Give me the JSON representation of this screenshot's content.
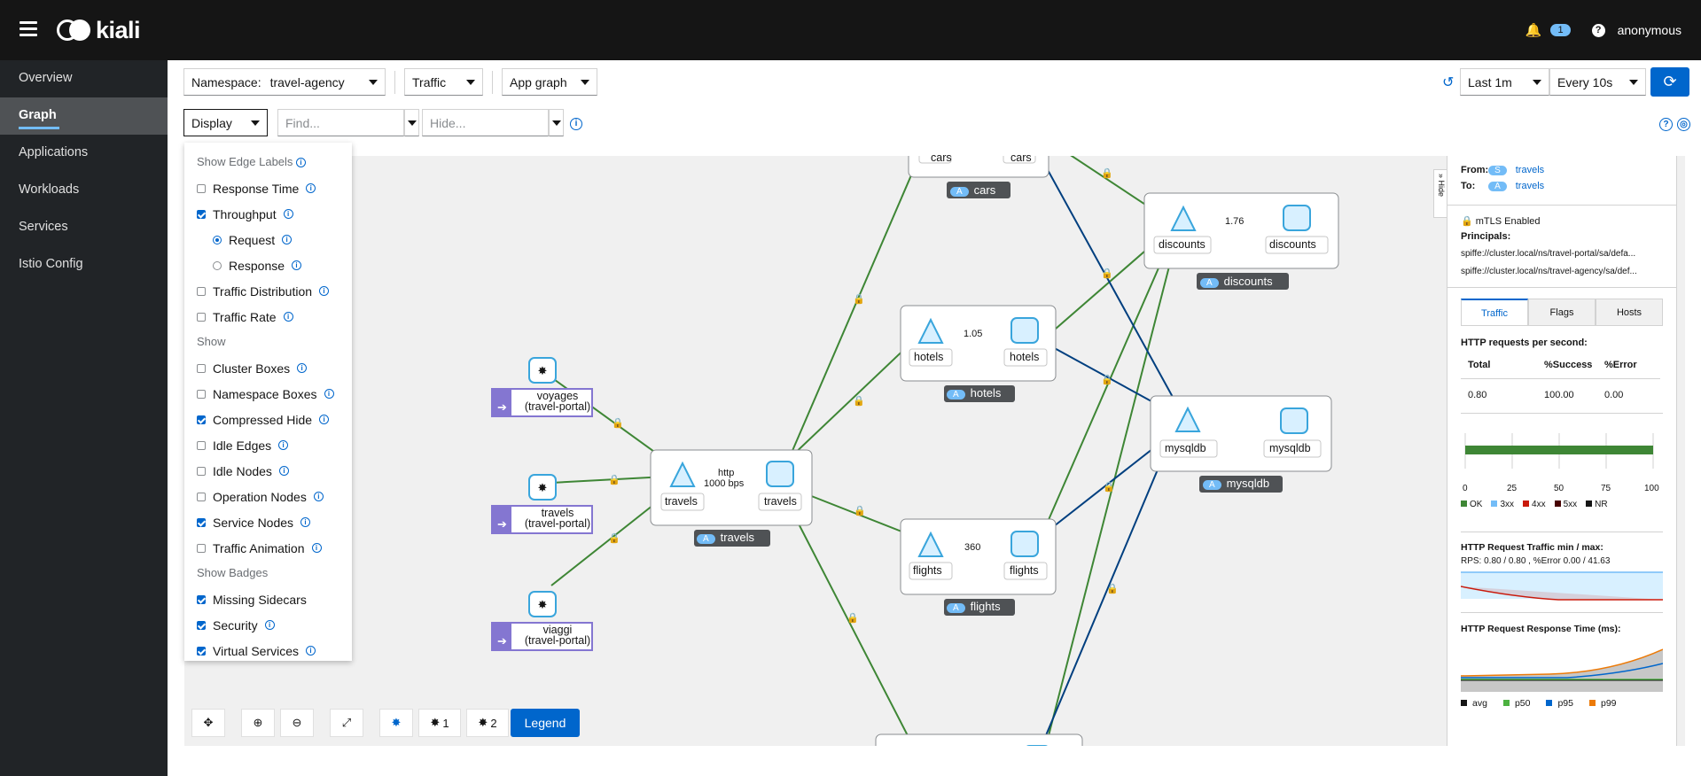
{
  "masthead": {
    "brand": "kiali",
    "notifications_count": "1",
    "user": "anonymous"
  },
  "sidebar": {
    "items": [
      {
        "label": "Overview"
      },
      {
        "label": "Graph"
      },
      {
        "label": "Applications"
      },
      {
        "label": "Workloads"
      },
      {
        "label": "Services"
      },
      {
        "label": "Istio Config"
      }
    ]
  },
  "toolbar": {
    "namespace_label": "Namespace:",
    "namespace_value": "travel-agency",
    "edge_label_select": "Traffic",
    "graph_type_select": "App graph",
    "duration": "Last 1m",
    "refresh_interval": "Every 10s",
    "display_label": "Display",
    "find_placeholder": "Find...",
    "hide_placeholder": "Hide..."
  },
  "display_menu": {
    "edge_labels_header": "Show Edge Labels",
    "response_time": "Response Time",
    "throughput": "Throughput",
    "request": "Request",
    "response": "Response",
    "traffic_distribution": "Traffic Distribution",
    "traffic_rate": "Traffic Rate",
    "show_header": "Show",
    "cluster_boxes": "Cluster Boxes",
    "namespace_boxes": "Namespace Boxes",
    "compressed_hide": "Compressed Hide",
    "idle_edges": "Idle Edges",
    "idle_nodes": "Idle Nodes",
    "operation_nodes": "Operation Nodes",
    "service_nodes": "Service Nodes",
    "traffic_animation": "Traffic Animation",
    "badges_header": "Show Badges",
    "missing_sidecars": "Missing Sidecars",
    "security": "Security",
    "virtual_services": "Virtual Services"
  },
  "graph": {
    "nodes": {
      "cars_svc": "cars",
      "cars_wl": "cars",
      "cars_app": "cars",
      "discounts_svc": "discounts",
      "discounts_wl": "discounts",
      "discounts_app": "discounts",
      "discounts_edge": "1.76",
      "hotels_svc": "hotels",
      "hotels_wl": "hotels",
      "hotels_app": "hotels",
      "hotels_edge": "1.05",
      "mysqldb_svc": "mysqldb",
      "mysqldb_wl": "mysqldb",
      "mysqldb_app": "mysqldb",
      "travels_svc": "travels",
      "travels_wl": "travels",
      "travels_app": "travels",
      "travels_edge_proto": "http",
      "travels_edge_rate": "1000 bps",
      "flights_svc": "flights",
      "flights_wl": "flights",
      "flights_app": "flights",
      "flights_edge": "360",
      "voyages_line1": "voyages",
      "voyages_line2": "(travel-portal)",
      "travelsp_line1": "travels",
      "travelsp_line2": "(travel-portal)",
      "viaggi_line1": "viaggi",
      "viaggi_line2": "(travel-portal)"
    },
    "app_badge": "A"
  },
  "side_panel": {
    "hide_label": "Hide",
    "from_label": "From:",
    "from_badge": "S",
    "from_value": "travels",
    "to_label": "To:",
    "to_badge": "A",
    "to_value": "travels",
    "mtls": "mTLS Enabled",
    "principals_label": "Principals:",
    "principal_1": "spiffe://cluster.local/ns/travel-portal/sa/defa...",
    "principal_2": "spiffe://cluster.local/ns/travel-agency/sa/def...",
    "tabs": [
      "Traffic",
      "Flags",
      "Hosts"
    ],
    "rps_title": "HTTP requests per second:",
    "col_total": "Total",
    "col_success": "%Success",
    "col_error": "%Error",
    "val_total": "0.80",
    "val_success": "100.00",
    "val_error": "0.00",
    "bar_ok_fraction": 1.0,
    "axis_ticks": [
      "0",
      "25",
      "50",
      "75",
      "100"
    ],
    "legend": [
      "OK",
      "3xx",
      "4xx",
      "5xx",
      "NR"
    ],
    "legend_colors": [
      "#3e8635",
      "#73bcf7",
      "#c9190b",
      "#470000",
      "#151515"
    ],
    "traffic_title": "HTTP Request Traffic min / max:",
    "traffic_summary": "RPS: 0.80 / 0.80 , %Error 0.00 / 41.63",
    "resp_title": "HTTP Request Response Time (ms):",
    "resp_legend": [
      "avg",
      "p50",
      "p95",
      "p99"
    ],
    "resp_colors": [
      "#151515",
      "#4cb140",
      "#0066cc",
      "#ec7a08"
    ]
  },
  "bottom_toolbar": {
    "legend": "Legend",
    "zoom_one": "1",
    "zoom_two": "2"
  }
}
